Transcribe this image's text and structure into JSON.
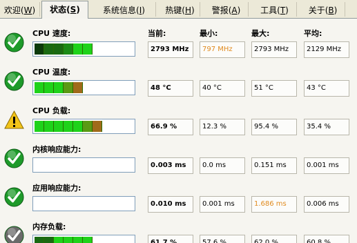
{
  "tabs": [
    {
      "label": "欢迎(",
      "hotkey": "W",
      "tail": ")"
    },
    {
      "label": "状态(",
      "hotkey": "S",
      "tail": ")",
      "active": true
    },
    {
      "label": "系统信息(",
      "hotkey": "I",
      "tail": ")"
    },
    {
      "label": "热键(",
      "hotkey": "H",
      "tail": ")"
    },
    {
      "label": "警报(",
      "hotkey": "A",
      "tail": ")"
    },
    {
      "label": "工具(",
      "hotkey": "T",
      "tail": ")"
    },
    {
      "label": "关于(",
      "hotkey": "B",
      "tail": ")"
    }
  ],
  "columns": {
    "current": "当前:",
    "min": "最小:",
    "max": "最大:",
    "avg": "平均:"
  },
  "rows": [
    {
      "label": "CPU 速度:",
      "status": "ok",
      "level": 0.55,
      "current": "2793 MHz",
      "min": "797 MHz",
      "max": "2793 MHz",
      "avg": "2129 MHz",
      "min_highlight": true,
      "max_highlight": false
    },
    {
      "label": "CPU 温度:",
      "status": "ok",
      "level": 0.48,
      "current": "48 °C",
      "min": "40 °C",
      "max": "51 °C",
      "avg": "43 °C",
      "min_highlight": false,
      "max_highlight": false
    },
    {
      "label": "CPU 负载:",
      "status": "warning",
      "level": 0.67,
      "current": "66.9 %",
      "min": "12.3 %",
      "max": "95.4 %",
      "avg": "35.4 %",
      "min_highlight": false,
      "max_highlight": false
    },
    {
      "label": "内核响应能力:",
      "status": "ok",
      "level": 0,
      "current": "0.003 ms",
      "min": "0.0 ms",
      "max": "0.151 ms",
      "avg": "0.001 ms",
      "min_highlight": false,
      "max_highlight": false
    },
    {
      "label": "应用响应能力:",
      "status": "ok",
      "level": 0,
      "current": "0.010 ms",
      "min": "0.001 ms",
      "max": "1.686 ms",
      "avg": "0.006 ms",
      "min_highlight": false,
      "max_highlight": true
    },
    {
      "label": "内存负载:",
      "status": "ok-gray",
      "level": 0.62,
      "current": "61.7 %",
      "min": "57.6 %",
      "max": "62.0 %",
      "avg": "60.8 %",
      "min_highlight": false,
      "max_highlight": false
    }
  ],
  "colors": {
    "ok": "#1e9a2a",
    "warning": "#f2c419",
    "highlight": "#e08a1e",
    "bar_green": "#1fd21a",
    "bar_dark": "#0c3a0a",
    "bar_brown": "#a06a1a"
  }
}
